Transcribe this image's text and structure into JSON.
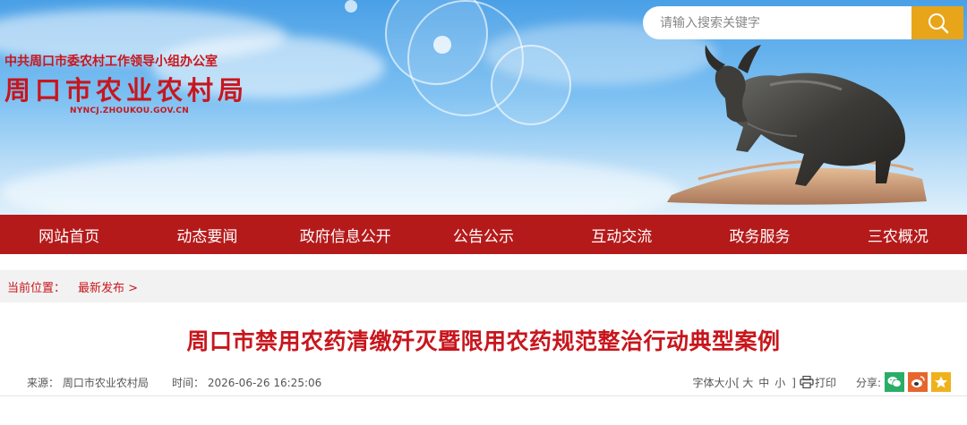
{
  "header": {
    "org_name": "中共周口市委农村工作领导小组办公室",
    "site_name": "周口市农业农村局",
    "domain": "NYNCJ.ZHOUKOU.GOV.CN"
  },
  "search": {
    "placeholder": "请输入搜索关键字",
    "icon": "search-icon"
  },
  "nav": {
    "items": [
      {
        "label": "网站首页"
      },
      {
        "label": "动态要闻"
      },
      {
        "label": "政府信息公开"
      },
      {
        "label": "公告公示"
      },
      {
        "label": "互动交流"
      },
      {
        "label": "政务服务"
      },
      {
        "label": "三农概况"
      }
    ]
  },
  "breadcrumb": {
    "label": "当前位置：",
    "current": "最新发布 >"
  },
  "article": {
    "title": "周口市禁用农药清缴歼灭暨限用农药规范整治行动典型案例",
    "source": "来源：  周口市农业农村局",
    "time": "时间：  2026-06-26 16:25:06"
  },
  "tools": {
    "font_size_prefix": "字体大小[",
    "font_large": "大",
    "font_medium": "中",
    "font_small": "小",
    "font_size_suffix": "]",
    "print_label": "打印",
    "share_label": "分享:"
  },
  "colors": {
    "brand_red": "#b51a1a",
    "title_red": "#c8161d",
    "search_btn": "#e8a51a",
    "wechat": "#2aae67",
    "weibo": "#e6662d",
    "favorite": "#f0b21c"
  }
}
